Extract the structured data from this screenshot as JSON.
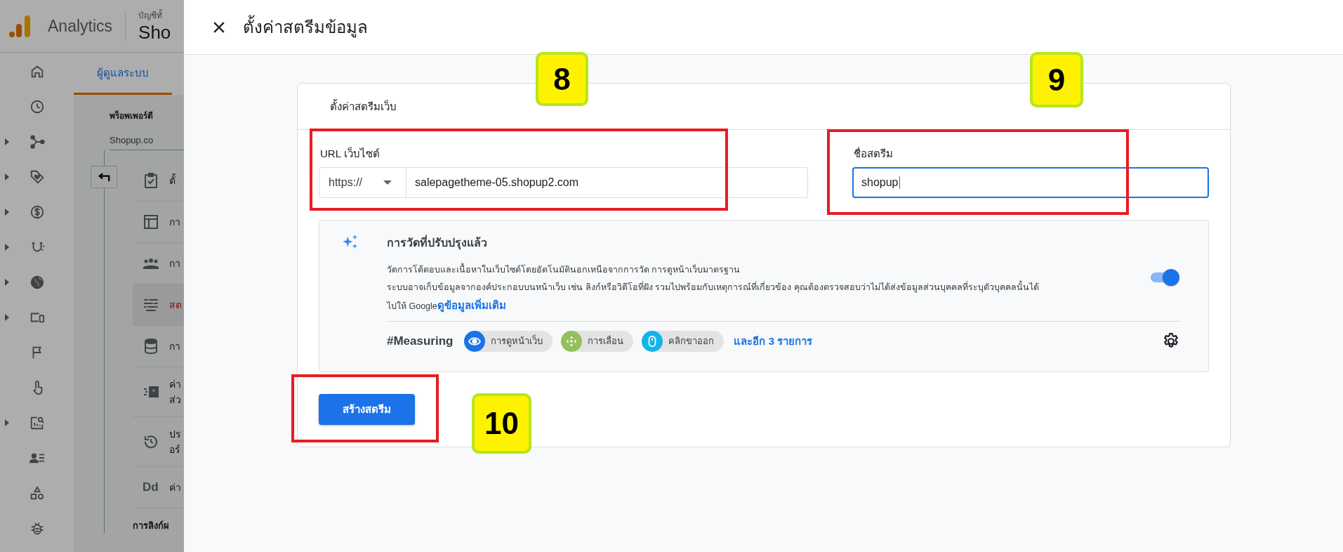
{
  "app": {
    "name": "Analytics",
    "account_label": "บัญชีทั้",
    "property_name": "Sho"
  },
  "rail": [
    {
      "kind": "home",
      "expandable": false
    },
    {
      "kind": "clock",
      "expandable": false
    },
    {
      "kind": "branch",
      "expandable": true
    },
    {
      "kind": "tag",
      "expandable": true
    },
    {
      "kind": "dollar",
      "expandable": true
    },
    {
      "kind": "magnet",
      "expandable": true
    },
    {
      "kind": "globe",
      "expandable": true
    },
    {
      "kind": "devices",
      "expandable": true
    },
    {
      "kind": "flag",
      "expandable": false
    },
    {
      "kind": "hand",
      "expandable": false
    },
    {
      "kind": "report",
      "expandable": true
    },
    {
      "kind": "people-list",
      "expandable": false
    },
    {
      "kind": "shapes",
      "expandable": false
    },
    {
      "kind": "bug",
      "expandable": false
    }
  ],
  "admin": {
    "tab": {
      "label": "ผู้ดูแลระบบ",
      "selected": true
    },
    "property_heading": "พร็อพเพอร์ตี",
    "property_value": "Shopup.co",
    "menu": [
      {
        "kind": "clipboard",
        "label": "ตั้",
        "selected": false
      },
      {
        "kind": "layout",
        "label": "กา",
        "selected": false
      },
      {
        "kind": "group",
        "label": "กา",
        "selected": false
      },
      {
        "kind": "streams",
        "label": "สต",
        "selected": true
      },
      {
        "kind": "database",
        "label": "กา",
        "selected": false
      },
      {
        "kind": "id-card",
        "label": "ค่า",
        "label_2": "ส่ว",
        "selected": false
      },
      {
        "kind": "history",
        "label": "ปร",
        "label_2": "อร์",
        "selected": false
      },
      {
        "kind": "glyph",
        "glyph": "Dd",
        "label": "ค่า",
        "selected": false
      }
    ],
    "section_heading": "การลิงก์ผ"
  },
  "dialog": {
    "title": "ตั้งค่าสตรีมข้อมูล",
    "card_title": "ตั้งค่าสตรีมเว็บ",
    "url": {
      "label": "URL เว็บไซต์",
      "protocol": "https://",
      "value": "salepagetheme-05.shopup2.com"
    },
    "stream_name": {
      "label": "ชื่อสตรีม",
      "value": "shopup",
      "focused": true
    },
    "enhanced": {
      "title": "การวัดที่ปรับปรุงแล้ว",
      "lines": [
        "วัดการโต้ตอบและเนื้อหาในเว็บไซต์โดยอัตโนมัตินอกเหนือจากการวัด การดูหน้าเว็บมาตรฐาน",
        "ระบบอาจเก็บข้อมูลจากองค์ประกอบบนหน้าเว็บ เช่น ลิงก์หรือวิดีโอที่ฝัง รวมไปพร้อมกับเหตุการณ์ที่เกี่ยวข้อง คุณต้องตรวจสอบว่าไม่ได้ส่งข้อมูลส่วนบุคคลที่ระบุตัวบุคคลนั้นได้",
        "ไปให้ Google"
      ],
      "link": "ดูข้อมูลเพิ่มเติม",
      "on": true,
      "measuring_label": "#Measuring",
      "chips": [
        {
          "kind": "eye",
          "label": "การดูหน้าเว็บ",
          "color": "#1a73e8"
        },
        {
          "kind": "scroll",
          "label": "การเลื่อน",
          "color": "#93c05a"
        },
        {
          "kind": "mouse",
          "label": "คลิกขาออก",
          "color": "#12b5ea"
        }
      ],
      "more": "และอีก 3 รายการ"
    },
    "submit": "สร้างสตรีม"
  },
  "callouts": [
    {
      "number": "8"
    },
    {
      "number": "9"
    },
    {
      "number": "10"
    }
  ]
}
